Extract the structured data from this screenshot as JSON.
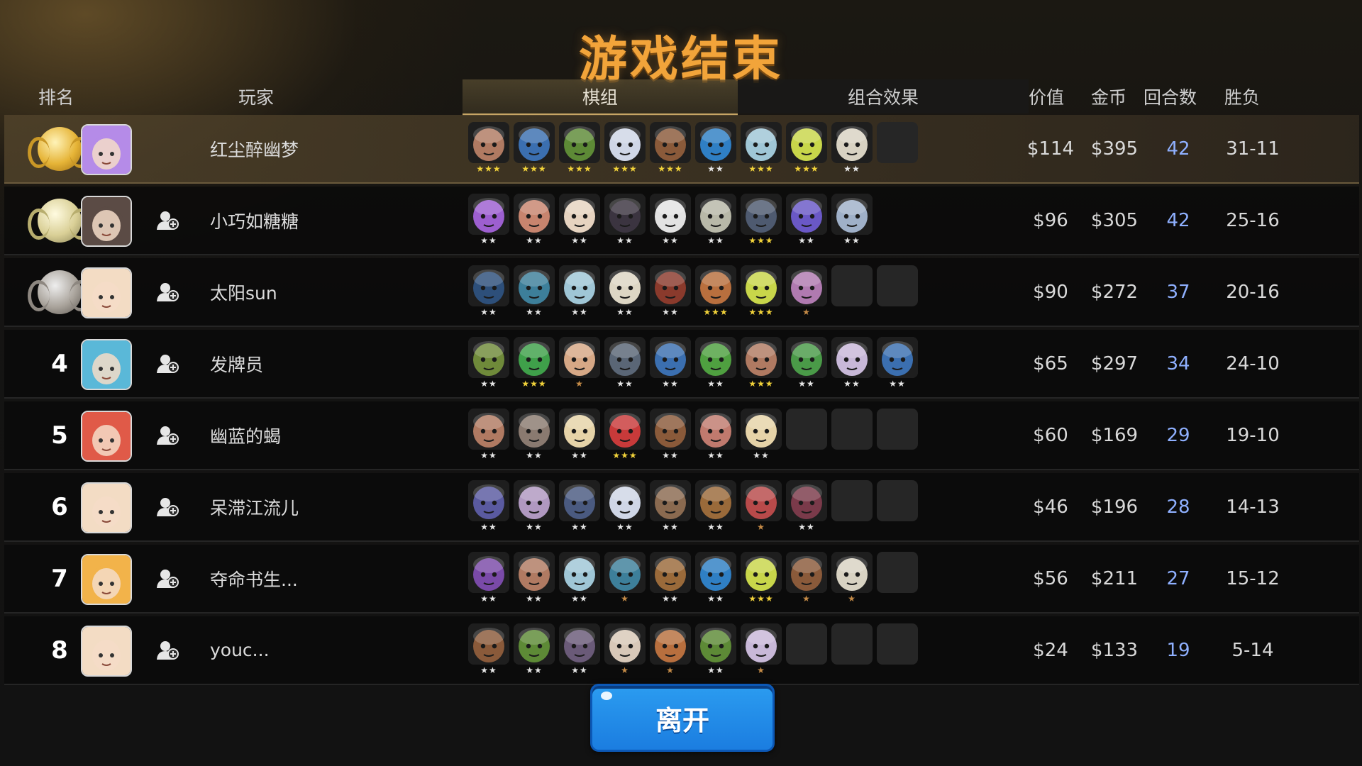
{
  "title": "游戏结束",
  "headers": {
    "rank": "排名",
    "player": "玩家",
    "pieces_tab": "棋组",
    "synergy_tab": "组合效果",
    "value": "价值",
    "gold": "金币",
    "rounds": "回合数",
    "winloss": "胜负"
  },
  "colors": {
    "title": "#f2a43a",
    "rounds_text": "#8fb0ff",
    "star_gold": "#f1d23a",
    "star_silver": "#e6e6e6",
    "star_bronze": "#c58b47",
    "leave_button": "#1f8ce8"
  },
  "rows": [
    {
      "rank": "1",
      "medal": "gold-medal",
      "avatar": "#b58be8",
      "friend_icon": false,
      "name": "红尘醉幽梦",
      "units": [
        {
          "c": "#b07a62",
          "s": 3
        },
        {
          "c": "#3b6fb0",
          "s": 3
        },
        {
          "c": "#5d8a36",
          "s": 3
        },
        {
          "c": "#cfd6e6",
          "s": 3
        },
        {
          "c": "#8a5a3a",
          "s": 3
        },
        {
          "c": "#2f7fc4",
          "s": 2
        },
        {
          "c": "#9fc6d6",
          "s": 3
        },
        {
          "c": "#c8d64a",
          "s": 3
        },
        {
          "c": "#d8d2c2",
          "s": 2
        },
        {
          "c": null,
          "s": 0
        }
      ],
      "value": "$114",
      "gold": "$395",
      "rounds": "42",
      "winloss": "31-11"
    },
    {
      "rank": "2",
      "medal": "silver-medal",
      "avatar": "#5b4b45",
      "friend_icon": true,
      "name": "小巧如糖糖",
      "units": [
        {
          "c": "#9d5fd0",
          "s": 2
        },
        {
          "c": "#c7846e",
          "s": 2
        },
        {
          "c": "#e6d3c0",
          "s": 2
        },
        {
          "c": "#3b3440",
          "s": 2
        },
        {
          "c": "#e2e2e2",
          "s": 2
        },
        {
          "c": "#b8b8a8",
          "s": 2
        },
        {
          "c": "#4e5a70",
          "s": 3
        },
        {
          "c": "#6a58c6",
          "s": 2
        },
        {
          "c": "#9fb0c8",
          "s": 2
        }
      ],
      "value": "$96",
      "gold": "$305",
      "rounds": "42",
      "winloss": "25-16"
    },
    {
      "rank": "3",
      "medal": "bronze-medal",
      "avatar": "#f3dcc4",
      "friend_icon": true,
      "name": "太阳sun",
      "units": [
        {
          "c": "#2d4f7a",
          "s": 2
        },
        {
          "c": "#3d7f9a",
          "s": 2
        },
        {
          "c": "#9fc6d6",
          "s": 2
        },
        {
          "c": "#ddd6c4",
          "s": 2
        },
        {
          "c": "#8a3a2c",
          "s": 2
        },
        {
          "c": "#b86f3e",
          "s": 3
        },
        {
          "c": "#c8d64a",
          "s": 3
        },
        {
          "c": "#b07ab0",
          "s": 1
        },
        {
          "c": null,
          "s": 0
        },
        {
          "c": null,
          "s": 0
        }
      ],
      "value": "$90",
      "gold": "$272",
      "rounds": "37",
      "winloss": "20-16"
    },
    {
      "rank": "4",
      "medal": "",
      "avatar": "#5ab8d8",
      "friend_icon": true,
      "name": "发牌员",
      "units": [
        {
          "c": "#6f8a3a",
          "s": 2
        },
        {
          "c": "#3fa04a",
          "s": 3
        },
        {
          "c": "#d6a886",
          "s": 1
        },
        {
          "c": "#5a6676",
          "s": 2
        },
        {
          "c": "#3b6fb0",
          "s": 2
        },
        {
          "c": "#4fa040",
          "s": 2
        },
        {
          "c": "#b07a62",
          "s": 3
        },
        {
          "c": "#4a9a48",
          "s": 2
        },
        {
          "c": "#c8b8d8",
          "s": 2
        },
        {
          "c": "#3b6fb0",
          "s": 2
        }
      ],
      "value": "$65",
      "gold": "$297",
      "rounds": "34",
      "winloss": "24-10"
    },
    {
      "rank": "5",
      "medal": "",
      "avatar": "#e05a48",
      "friend_icon": true,
      "name": "幽蓝的蝎",
      "units": [
        {
          "c": "#b07a62",
          "s": 2
        },
        {
          "c": "#8a7a70",
          "s": 2
        },
        {
          "c": "#e6d3a8",
          "s": 2
        },
        {
          "c": "#c83a3a",
          "s": 3
        },
        {
          "c": "#8a5a3a",
          "s": 2
        },
        {
          "c": "#c07a6e",
          "s": 2
        },
        {
          "c": "#e6d3a8",
          "s": 2
        },
        {
          "c": null,
          "s": 0
        },
        {
          "c": null,
          "s": 0
        },
        {
          "c": null,
          "s": 0
        }
      ],
      "value": "$60",
      "gold": "$169",
      "rounds": "29",
      "winloss": "19-10"
    },
    {
      "rank": "6",
      "medal": "",
      "avatar": "#f3dcc4",
      "friend_icon": true,
      "name": "呆滞江流儿",
      "units": [
        {
          "c": "#5a5aa0",
          "s": 2
        },
        {
          "c": "#b098c0",
          "s": 2
        },
        {
          "c": "#4a5a80",
          "s": 2
        },
        {
          "c": "#cfd6e6",
          "s": 2
        },
        {
          "c": "#8a6a50",
          "s": 2
        },
        {
          "c": "#9a6a3a",
          "s": 2
        },
        {
          "c": "#b84a4a",
          "s": 1
        },
        {
          "c": "#7a3a4a",
          "s": 2
        },
        {
          "c": null,
          "s": 0
        },
        {
          "c": null,
          "s": 0
        }
      ],
      "value": "$46",
      "gold": "$196",
      "rounds": "28",
      "winloss": "14-13"
    },
    {
      "rank": "7",
      "medal": "",
      "avatar": "#f2b34a",
      "friend_icon": true,
      "name": "夺命书生...",
      "units": [
        {
          "c": "#7a4aa8",
          "s": 2
        },
        {
          "c": "#b07a62",
          "s": 2
        },
        {
          "c": "#9fc6d6",
          "s": 2
        },
        {
          "c": "#3d7f9a",
          "s": 1
        },
        {
          "c": "#9a6a3a",
          "s": 2
        },
        {
          "c": "#2f7fc4",
          "s": 2
        },
        {
          "c": "#c8d64a",
          "s": 3
        },
        {
          "c": "#8a5a3a",
          "s": 1
        },
        {
          "c": "#d8d2c2",
          "s": 1
        },
        {
          "c": null,
          "s": 0
        }
      ],
      "value": "$56",
      "gold": "$211",
      "rounds": "27",
      "winloss": "15-12"
    },
    {
      "rank": "8",
      "medal": "",
      "avatar": "#f3dcc4",
      "friend_icon": true,
      "name": "youc...",
      "units": [
        {
          "c": "#8a5a3a",
          "s": 2
        },
        {
          "c": "#5d8a36",
          "s": 2
        },
        {
          "c": "#6a5a78",
          "s": 2
        },
        {
          "c": "#d8c8b8",
          "s": 1
        },
        {
          "c": "#b86f3e",
          "s": 1
        },
        {
          "c": "#5d8a36",
          "s": 2
        },
        {
          "c": "#c8b8d8",
          "s": 1
        },
        {
          "c": null,
          "s": 0
        },
        {
          "c": null,
          "s": 0
        },
        {
          "c": null,
          "s": 0
        }
      ],
      "value": "$24",
      "gold": "$133",
      "rounds": "19",
      "winloss": "5-14"
    }
  ],
  "leave_button": "离开"
}
